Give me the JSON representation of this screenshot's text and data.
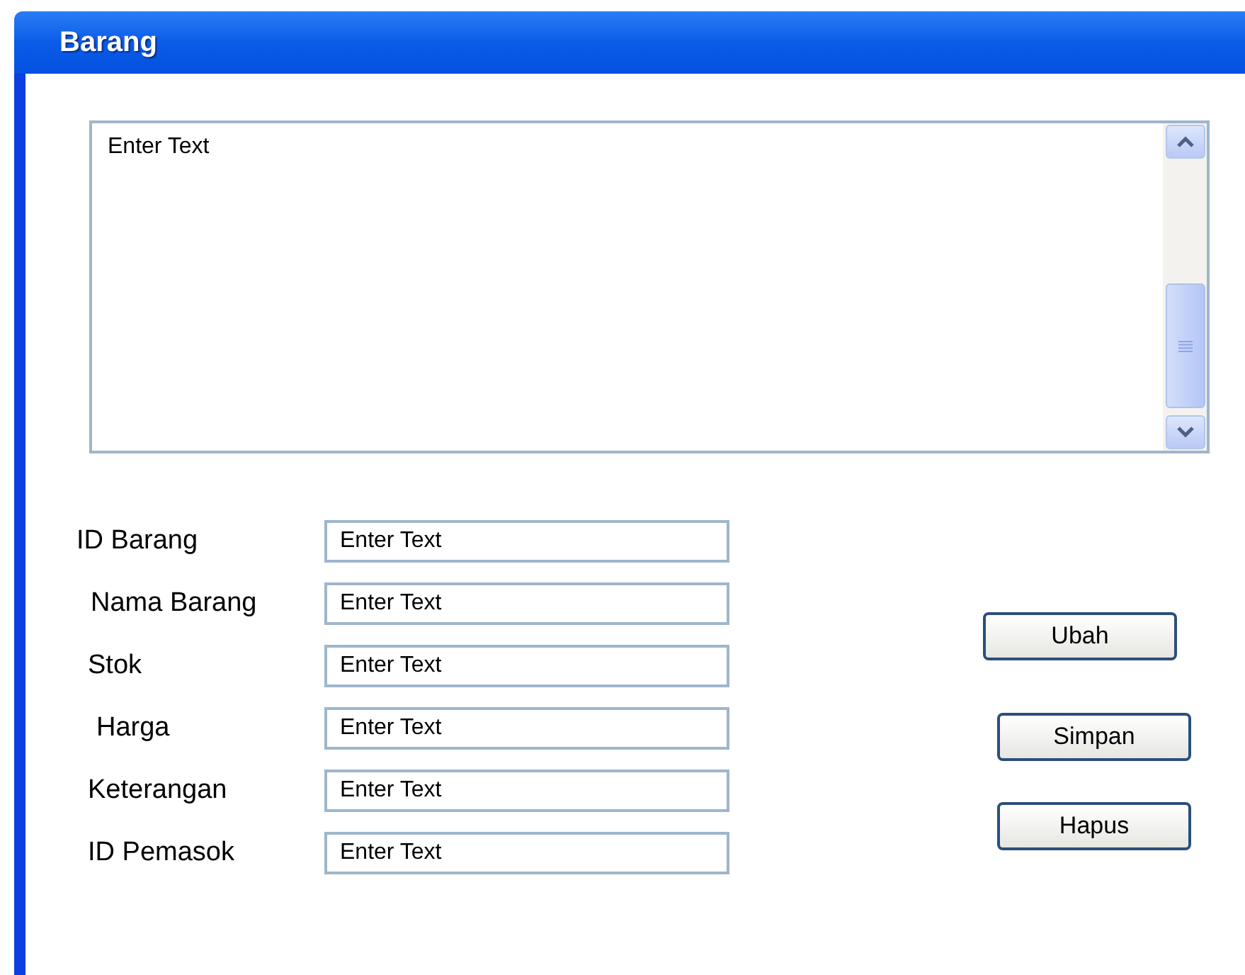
{
  "window": {
    "title": "Barang"
  },
  "text_area": {
    "placeholder": "Enter Text"
  },
  "fields": [
    {
      "label": "ID Barang",
      "placeholder": "Enter Text"
    },
    {
      "label": "Nama Barang",
      "placeholder": "Enter Text"
    },
    {
      "label": "Stok",
      "placeholder": "Enter Text"
    },
    {
      "label": "Harga",
      "placeholder": "Enter Text"
    },
    {
      "label": "Keterangan",
      "placeholder": "Enter Text"
    },
    {
      "label": "ID Pemasok",
      "placeholder": "Enter Text"
    }
  ],
  "buttons": [
    "Ubah",
    "Simpan",
    "Hapus"
  ]
}
